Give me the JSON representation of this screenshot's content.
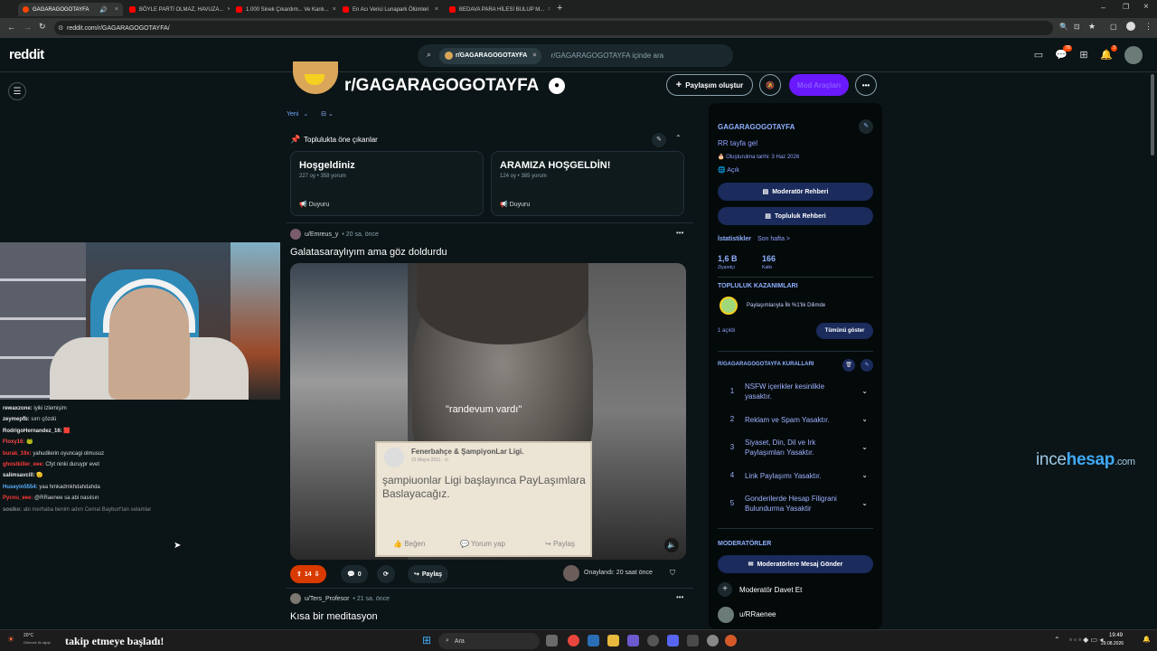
{
  "browser": {
    "tabs": [
      {
        "title": "GAGARAGOGOTAYFA",
        "type": "reddit",
        "active": true
      },
      {
        "title": "BÖYLE PARTİ OLMAZ, HAVUZA...",
        "type": "youtube",
        "active": false
      },
      {
        "title": "1.000 Sinek Çıkardım... Ve Kanlı...",
        "type": "youtube",
        "active": false
      },
      {
        "title": "En Acı Verici Lunapark Ölümleri",
        "type": "youtube",
        "active": false
      },
      {
        "title": "BEDAVA PARA HİLESİ BULUP M...",
        "type": "youtube",
        "active": false
      }
    ],
    "url": "reddit.com/r/GAGARAGOGOTAYFA/"
  },
  "header": {
    "logo": "reddit",
    "search_chip": "r/GAGARAGOGOTAYFA",
    "search_placeholder": "r/GAGARAGOGOTAYFA içinde ara",
    "chat_badge": "78",
    "notif_badge": "3"
  },
  "subreddit": {
    "name": "r/GAGARAGOGOTAYFA",
    "create_post": "Paylaşım oluştur",
    "join": "Mod Araçları",
    "sort": "Yeni",
    "highlights_title": "Toplulukta öne çıkanlar",
    "highlights": [
      {
        "title": "Hoşgeldiniz",
        "meta": "227 oy • 358 yorum",
        "tag": "Duyuru"
      },
      {
        "title": "ARAMIZA HOŞGELDİN!",
        "meta": "124 oy • 385 yorum",
        "tag": "Duyuru"
      }
    ]
  },
  "posts": [
    {
      "user": "u/Emreus_y",
      "time": "• 20 sa. önce",
      "title": "Galatasaraylıyım ama göz doldurdu",
      "video_quote": "\"randevum vardı\"",
      "fb_header": "Fenerbahçe & ŞampiyonLar Ligi.",
      "fb_date": "31 Mayıs 2011 · ⊙",
      "fb_body": "şampiuonlar Ligi başlayınca PayLaşımlara Baslayacağız.",
      "fb_like": "Beğen",
      "fb_comment": "Yorum yap",
      "fb_share": "Paylaş",
      "votes": "14",
      "comments": "0",
      "share": "Paylaş",
      "approved": "Onaylandı: 20 saat önce"
    },
    {
      "user": "u/Ters_Profesor",
      "time": "• 21 sa. önce",
      "title": "Kısa bir meditasyon"
    }
  ],
  "sidebar": {
    "title": "GAGARAGOGOTAYFA",
    "desc": "RR tayfa gel",
    "created": "Oluşturulma tarihi: 3 Haz 2026",
    "visibility": "Açık",
    "mod_guide": "Moderatör Rehberi",
    "community_guide": "Topluluk Rehberi",
    "stats_label": "İstatistikler",
    "stats_period": "Son hafta >",
    "visitors_value": "1,6 B",
    "visitors_label": "Ziyaretçi",
    "contrib_value": "166",
    "contrib_label": "Katkı",
    "achievements_title": "TOPLULUK KAZANIMLARI",
    "achievement": "Paylaşımlarıyla İlk %1'lik Dilimde",
    "unlocked": "1 açıldı",
    "show_all": "Tümünü göster",
    "rules_title": "R/GAGARAGOGOTAYFA KURALLARI",
    "rules": [
      {
        "n": "1",
        "text": "NSFW içerikler kesinlikle yasaktır."
      },
      {
        "n": "2",
        "text": "Reklam ve Spam Yasaktır."
      },
      {
        "n": "3",
        "text": "Siyaset, Din, Dil ve Irk Paylaşımları Yasaktır."
      },
      {
        "n": "4",
        "text": "Link Paylaşımı Yasaktır."
      },
      {
        "n": "5",
        "text": "Gonderilerde Hesap Filigrani Bulundurma Yasaktir"
      }
    ],
    "mods_title": "MODERATÖRLER",
    "message_mods": "Moderatörlere Mesaj Gönder",
    "invite_mod": "Moderatör Davet Et",
    "mod_user": "u/RRaenee"
  },
  "chat": [
    {
      "user": "rewaxzone:",
      "msg": "iyiki izlemişim",
      "color": "#e8e8e8"
    },
    {
      "user": "zeymepfb:",
      "msg": "sırrı çözdü",
      "color": "#e8e8e8"
    },
    {
      "user": "RodrigoHernandez_16:",
      "msg": "🟥",
      "color": "#e8e8e8"
    },
    {
      "user": "Floxy16:",
      "msg": "🐸",
      "color": "#ff4d4d"
    },
    {
      "user": "burak_19x:",
      "msg": "yahudilerin oyuncagi olmusuz",
      "color": "#ff3b3b"
    },
    {
      "user": "ghostkiller_eee:",
      "msg": "Cfyt ninki duruypr evet",
      "color": "#ff3b3b"
    },
    {
      "user": "salimsavcill:",
      "msg": "🫡",
      "color": "#e8e8e8"
    },
    {
      "user": "Huseyin5554:",
      "msg": "yaa hmkadmkhdahdahda",
      "color": "#5ab0ff"
    },
    {
      "user": "Pycnu_eee:",
      "msg": "@RRaenee sa abi nasılsın",
      "color": "#ff3b3b"
    },
    {
      "user": "sosiko:",
      "msg": "abi merhaba benim adım Cemal Bayburt'tan selamlar",
      "color": "#8a8a8a"
    }
  ],
  "watermark": {
    "a": "ince",
    "b": "hesap",
    "c": ".com"
  },
  "taskbar": {
    "weather_temp": "20°C",
    "weather_desc": "Gelecek ilk ağışlı",
    "follow_text": "takip etmeye başladı!",
    "search": "Ara",
    "time": "19:49",
    "date": "29.08.2026"
  },
  "colors": {
    "accent": "#ff4500",
    "bg": "#0b1416",
    "vote": "#d93a00",
    "join": "#6a19ff"
  }
}
